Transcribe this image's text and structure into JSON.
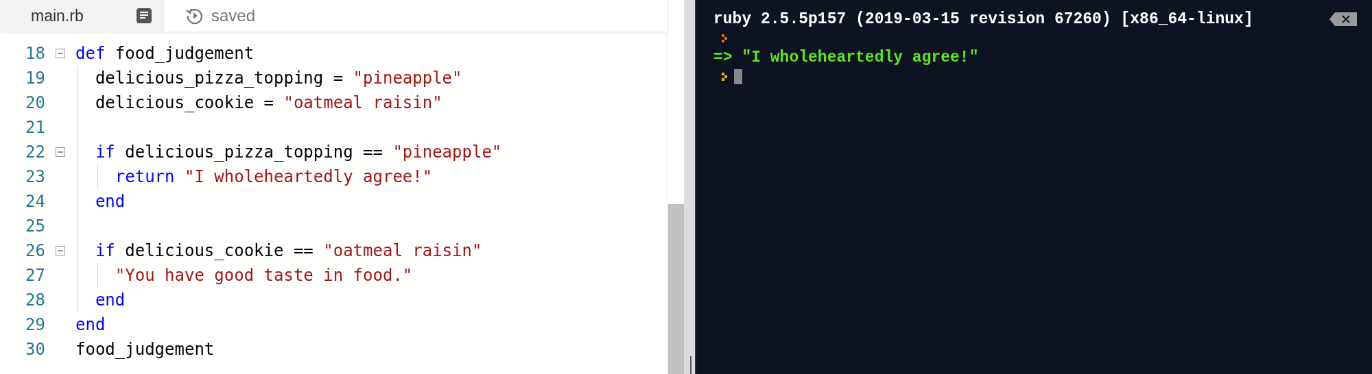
{
  "editor": {
    "tab": {
      "label": "main.rb"
    },
    "status": "saved",
    "lines": [
      {
        "number": "18",
        "foldable": true,
        "tokens": [
          {
            "kind": "keyword",
            "text": "def"
          },
          {
            "kind": "plain",
            "text": " food_judgement"
          }
        ]
      },
      {
        "number": "19",
        "foldable": false,
        "tokens": [
          {
            "kind": "plain",
            "text": "  delicious_pizza_topping = "
          },
          {
            "kind": "string",
            "text": "\"pineapple\""
          }
        ]
      },
      {
        "number": "20",
        "foldable": false,
        "tokens": [
          {
            "kind": "plain",
            "text": "  delicious_cookie = "
          },
          {
            "kind": "string",
            "text": "\"oatmeal raisin\""
          }
        ]
      },
      {
        "number": "21",
        "foldable": false
      },
      {
        "number": "22",
        "foldable": true,
        "tokens": [
          {
            "kind": "keyword",
            "text": "  if"
          },
          {
            "kind": "plain",
            "text": " delicious_pizza_topping == "
          },
          {
            "kind": "string",
            "text": "\"pineapple\""
          }
        ]
      },
      {
        "number": "23",
        "foldable": false,
        "tokens": [
          {
            "kind": "keyword",
            "text": "    return"
          },
          {
            "kind": "string",
            "text": " \"I wholeheartedly agree!\""
          }
        ]
      },
      {
        "number": "24",
        "foldable": false,
        "tokens": [
          {
            "kind": "keyword",
            "text": "  end"
          }
        ]
      },
      {
        "number": "25",
        "foldable": false
      },
      {
        "number": "26",
        "foldable": true,
        "tokens": [
          {
            "kind": "keyword",
            "text": "  if"
          },
          {
            "kind": "plain",
            "text": " delicious_cookie == "
          },
          {
            "kind": "string",
            "text": "\"oatmeal raisin\""
          }
        ]
      },
      {
        "number": "27",
        "foldable": false,
        "tokens": [
          {
            "kind": "string",
            "text": "    \"You have good taste in food.\""
          }
        ]
      },
      {
        "number": "28",
        "foldable": false,
        "tokens": [
          {
            "kind": "keyword",
            "text": "  end"
          }
        ]
      },
      {
        "number": "29",
        "foldable": false,
        "tokens": [
          {
            "kind": "keyword",
            "text": "end"
          }
        ]
      },
      {
        "number": "30",
        "foldable": false,
        "tokens": [
          {
            "kind": "plain",
            "text": "food_judgement"
          }
        ]
      }
    ]
  },
  "console": {
    "lines": [
      {
        "kind": "text",
        "text": "ruby 2.5.5p157 (2019-03-15 revision 67260) [x86_64-linux]"
      },
      {
        "kind": "prompt",
        "color": "#e8641c",
        "cursor": false
      },
      {
        "kind": "result",
        "text": "=> \"I wholeheartedly agree!\""
      },
      {
        "kind": "prompt",
        "color": "#f0b400",
        "cursor": true
      }
    ]
  }
}
